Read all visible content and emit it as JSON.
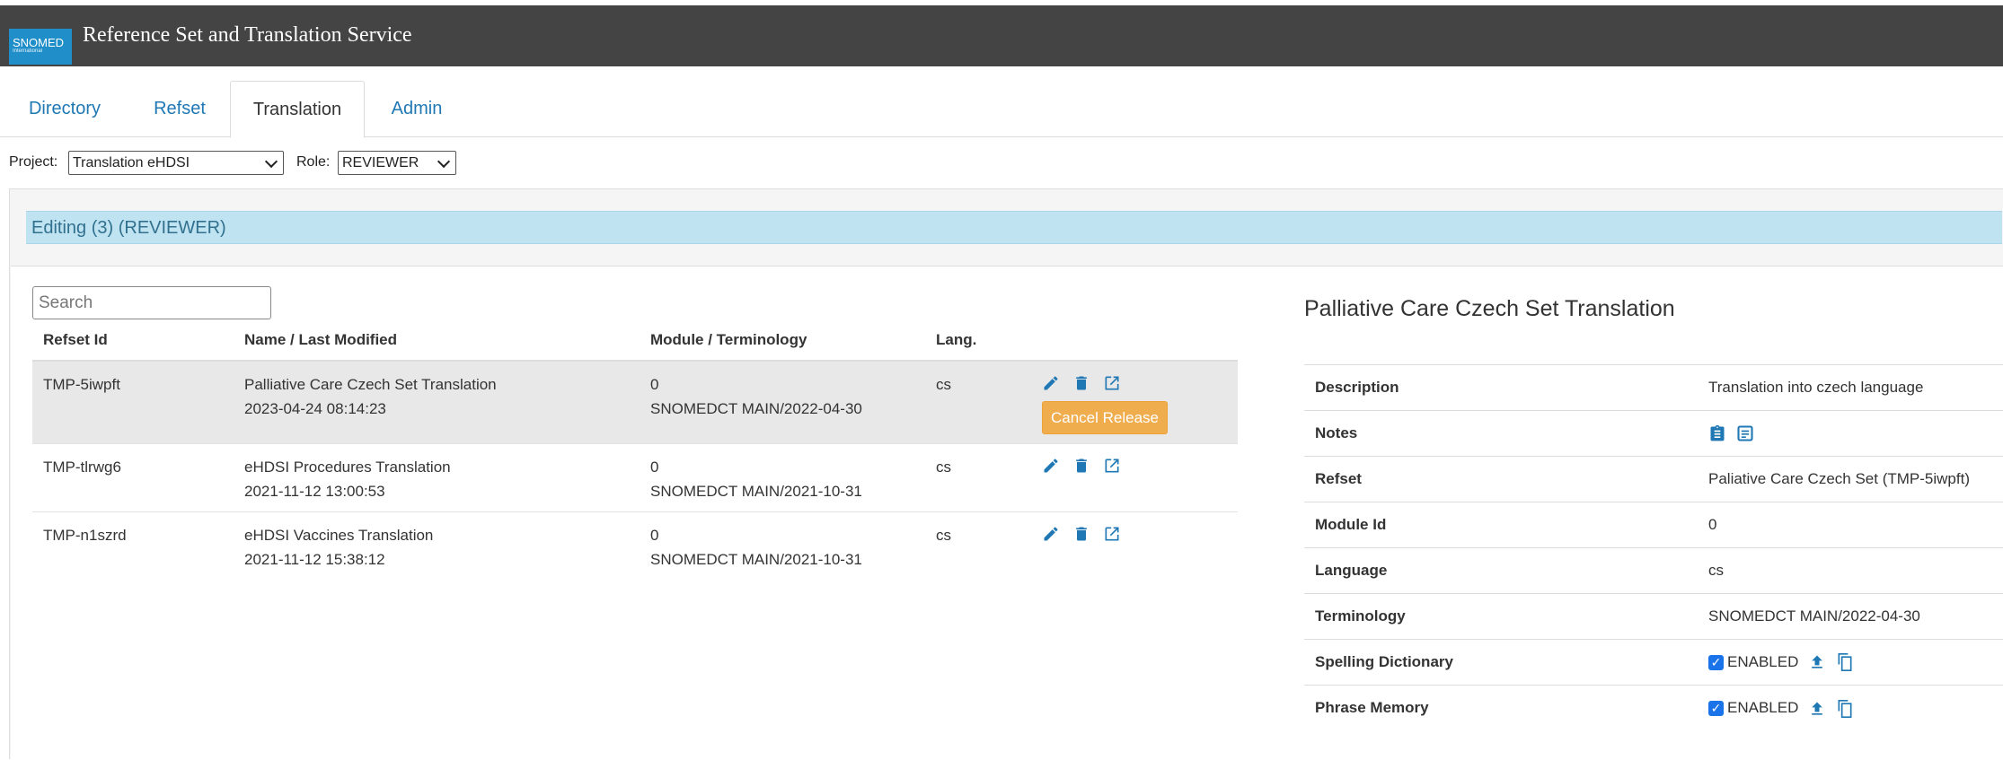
{
  "app": {
    "logo_text": "SNOMED",
    "logo_sub": "International",
    "title": "Reference Set and Translation Service"
  },
  "tabs": [
    {
      "label": "Directory"
    },
    {
      "label": "Refset"
    },
    {
      "label": "Translation",
      "active": true
    },
    {
      "label": "Admin"
    }
  ],
  "project": {
    "label": "Project:",
    "value": "Translation eHDSI"
  },
  "role": {
    "label": "Role:",
    "value": "REVIEWER"
  },
  "panel": {
    "heading": "Editing (3) (REVIEWER)"
  },
  "search": {
    "placeholder": "Search"
  },
  "list": {
    "headers": [
      "Refset Id",
      "Name / Last Modified",
      "Module / Terminology",
      "Lang."
    ],
    "rows": [
      {
        "id": "TMP-5iwpft",
        "name": "Palliative Care Czech Set Translation",
        "modified": "2023-04-24 08:14:23",
        "module": "0",
        "terminology": "SNOMEDCT MAIN/2022-04-30",
        "lang": "cs",
        "cancel_label": "Cancel Release"
      },
      {
        "id": "TMP-tlrwg6",
        "name": "eHDSI Procedures Translation",
        "modified": "2021-11-12 13:00:53",
        "module": "0",
        "terminology": "SNOMEDCT MAIN/2021-10-31",
        "lang": "cs"
      },
      {
        "id": "TMP-n1szrd",
        "name": "eHDSI Vaccines Translation",
        "modified": "2021-11-12 15:38:12",
        "module": "0",
        "terminology": "SNOMEDCT MAIN/2021-10-31",
        "lang": "cs"
      }
    ]
  },
  "detail": {
    "title": "Palliative Care Czech Set Translation",
    "description_label": "Description",
    "description": "Translation into czech language",
    "notes_label": "Notes",
    "refset_label": "Refset",
    "refset": "Paliative Care Czech Set (TMP-5iwpft)",
    "module_label": "Module Id",
    "module": "0",
    "language_label": "Language",
    "language": "cs",
    "terminology_label": "Terminology",
    "terminology": "SNOMEDCT MAIN/2022-04-30",
    "spelling_label": "Spelling Dictionary",
    "spelling_status": "ENABLED",
    "phrase_label": "Phrase Memory",
    "phrase_status": "ENABLED"
  },
  "colors": {
    "header_bg": "#444444",
    "link": "#1f78b4",
    "panel_head": "#bfe3f0",
    "cancel": "#f0ad4e",
    "checkbox": "#1a73e8"
  }
}
